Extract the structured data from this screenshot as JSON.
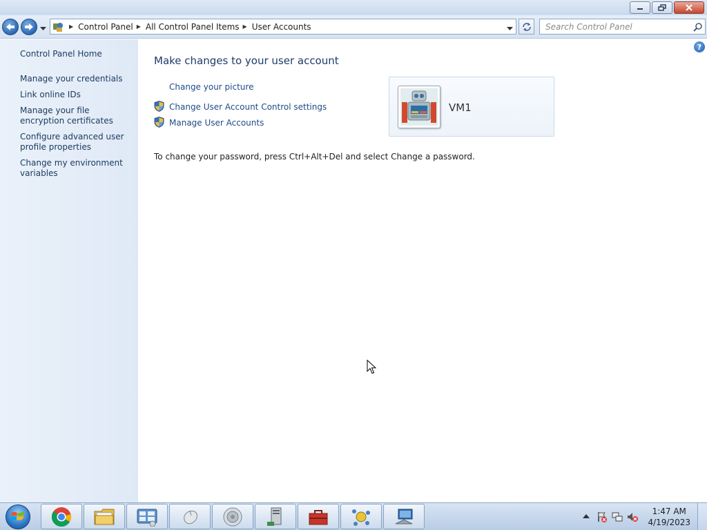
{
  "window": {
    "breadcrumbs": [
      "Control Panel",
      "All Control Panel Items",
      "User Accounts"
    ],
    "search_placeholder": "Search Control Panel"
  },
  "sidebar": {
    "items": [
      {
        "label": "Control Panel Home"
      },
      {
        "label": "Manage your credentials"
      },
      {
        "label": "Link online IDs"
      },
      {
        "label": "Manage your file encryption certificates"
      },
      {
        "label": "Configure advanced user profile properties"
      },
      {
        "label": "Change my environment variables"
      }
    ]
  },
  "main": {
    "heading": "Make changes to your user account",
    "tasks": [
      {
        "label": "Change your picture",
        "icon": "none"
      },
      {
        "label": "Change User Account Control settings",
        "icon": "uac-shield-icon"
      },
      {
        "label": "Manage User Accounts",
        "icon": "uac-shield-icon"
      }
    ],
    "user": {
      "name": "VM1"
    },
    "info": "To change your password, press Ctrl+Alt+Del and select Change a password.",
    "help_glyph": "?"
  },
  "taskbar": {
    "items": [
      "chrome-icon",
      "file-explorer-icon",
      "control-panel-icon",
      "mouse-icon",
      "speaker-icon",
      "server-icon",
      "toolbox-icon",
      "network-icon",
      "remote-desktop-icon"
    ],
    "clock": {
      "time": "1:47 AM",
      "date": "4/19/2023"
    }
  },
  "colors": {
    "link": "#1e4a88",
    "heading": "#1e3b6a",
    "sidebar_bg": "#e4edf8",
    "taskbar_bg": "#c8d9ee"
  }
}
